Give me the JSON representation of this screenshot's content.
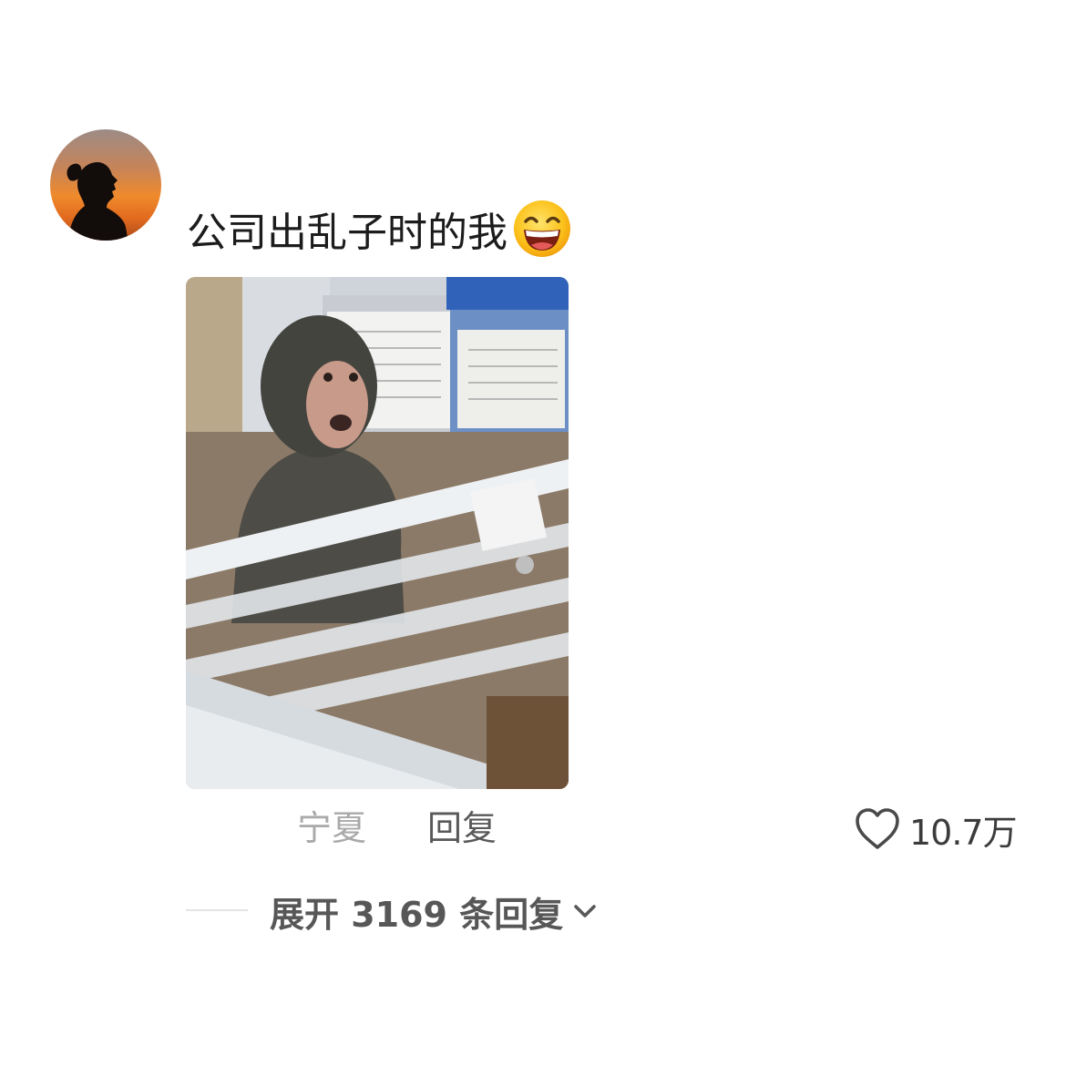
{
  "comment": {
    "avatar_icon": "silhouette-sunset-avatar",
    "text": "公司出乱子时的我",
    "emoji_icon": "grinning-squinting-face-emoji",
    "photo_icon": "monkey-in-office-cubicle-photo",
    "location": "宁夏",
    "reply_label": "回复",
    "like_icon": "heart-icon",
    "like_count": "10.7万"
  },
  "replies": {
    "expand_label": "展开 3169 条回复",
    "expand_icon": "chevron-down-icon"
  },
  "colors": {
    "text_primary": "#1c1c1c",
    "text_muted": "#a9a9a9",
    "text_secondary": "#575757"
  }
}
